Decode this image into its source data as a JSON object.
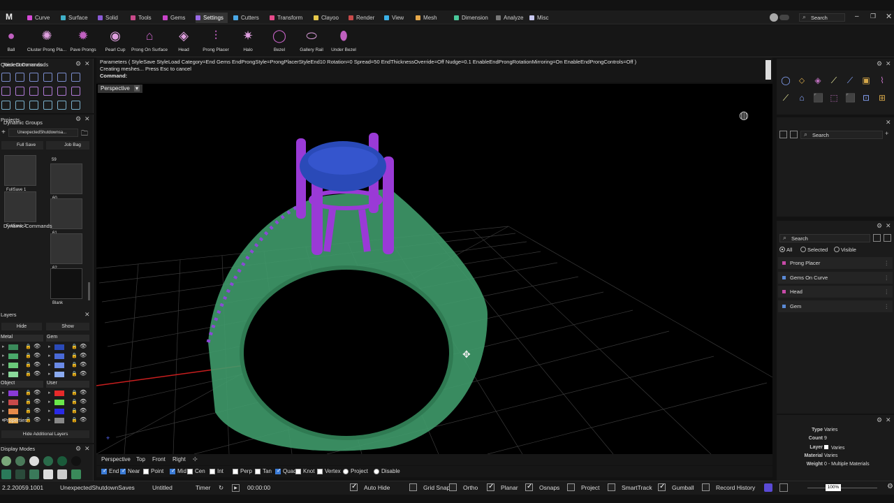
{
  "app": {
    "logo": "M"
  },
  "tabs": [
    {
      "label": "Curve",
      "color": "#d64ad6"
    },
    {
      "label": "Surface",
      "color": "#3fb0c8"
    },
    {
      "label": "Solid",
      "color": "#8a5ad6"
    },
    {
      "label": "Tools",
      "color": "#c84a8a"
    },
    {
      "label": "Gems",
      "color": "#c844c8"
    },
    {
      "label": "Settings",
      "color": "#9a6ae6"
    },
    {
      "label": "Cutters",
      "color": "#4aa8e6"
    },
    {
      "label": "Transform",
      "color": "#e64a8a"
    },
    {
      "label": "Clayoo",
      "color": "#e6c84a"
    },
    {
      "label": "Render",
      "color": "#c84a4a"
    },
    {
      "label": "View",
      "color": "#3ab0e6"
    },
    {
      "label": "Mesh",
      "color": "#e6a84a"
    },
    {
      "label": "Dimension",
      "color": "#4ac89a"
    },
    {
      "label": "Analyze",
      "color": "#777777"
    },
    {
      "label": "Misc",
      "color": "#c8c8f0"
    }
  ],
  "top_search": "Search",
  "tools": [
    "Ball",
    "Cluster Prong Pla...",
    "Pave Prongs",
    "Pearl Cup",
    "Prong On Surface",
    "Head",
    "Prong Placer",
    "Halo",
    "Bezel",
    "Gallery Rail",
    "Under Bezel"
  ],
  "command": {
    "line1": "Parameters ( StyleSave StyleLoad Category=End Gems EndProngStyle=ProngPlacerStyleEnd10 Rotation=0 Spread=50 EndThicknessOverride=Off Nudge=0.1 EnableEndProngRotationMirroring=On EnableEndProngControls=Off )",
    "line2": "Creating meshes... Press Esc to cancel",
    "line3": "Command:"
  },
  "viewport_label": "Perspective",
  "panels": {
    "quick_commands": "Quick Commands",
    "projects": "Projects",
    "project_name": "UnexpectedShutdownsa...",
    "full_save": "Full Save",
    "job_bag": "Job Bag",
    "thumbs": [
      {
        "num": "",
        "cap": "FullSave 1"
      },
      {
        "num": "59",
        "cap": "60"
      },
      {
        "num": "",
        "cap": "FullSave 2"
      },
      {
        "num": "",
        "cap": "61"
      },
      {
        "num": "",
        "cap": "62"
      },
      {
        "num": "",
        "cap": "Blank"
      }
    ],
    "layers": "Layers",
    "hide": "Hide",
    "show": "Show",
    "layer_groups": [
      "Metal",
      "Gem",
      "Object",
      "User"
    ],
    "hide_additional": "Hide Additional Layers",
    "display_modes": "Display Modes"
  },
  "right": {
    "recent": "Recent Commands",
    "dyn_groups": "Dynamic Groups",
    "dyn_groups_search": "Search",
    "dyn_cmds": "Dynamic Commands",
    "dyn_cmds_search": "Search",
    "filters": [
      "All",
      "Selected",
      "Visible"
    ],
    "dyn_items": [
      {
        "label": "Prong Placer",
        "color": "#c84aa8"
      },
      {
        "label": "Gems On Curve",
        "color": "#5a8ad6"
      },
      {
        "label": "Head",
        "color": "#c84aa8"
      },
      {
        "label": "Gem",
        "color": "#5a8ad6"
      }
    ],
    "properties": "Properties",
    "props": [
      {
        "k": "Type",
        "v": "Varies"
      },
      {
        "k": "Count",
        "v": "9"
      },
      {
        "k": "Layer",
        "v": "Varies"
      },
      {
        "k": "Material",
        "v": "Varies"
      },
      {
        "k": "Weight",
        "v": "0 - Multiple Materials"
      }
    ]
  },
  "view_tabs": [
    "Perspective",
    "Top",
    "Front",
    "Right"
  ],
  "snaps": [
    {
      "label": "End",
      "on": true
    },
    {
      "label": "Near",
      "on": true
    },
    {
      "label": "Point",
      "on": false
    },
    {
      "label": "Mid",
      "on": true
    },
    {
      "label": "Cen",
      "on": false
    },
    {
      "label": "Int",
      "on": false
    },
    {
      "label": "Perp",
      "on": false
    },
    {
      "label": "Tan",
      "on": false
    },
    {
      "label": "Quad",
      "on": true
    },
    {
      "label": "Knot",
      "on": false
    },
    {
      "label": "Vertex",
      "on": false
    },
    {
      "label": "Project",
      "on": false
    },
    {
      "label": "Disable",
      "on": false
    }
  ],
  "status": {
    "version": "2.2.20059.1001",
    "saves": "UnexpectedShutdownSaves",
    "file": "Untitled",
    "timer": "Timer",
    "time": "00:00:00",
    "toggles": [
      {
        "label": "Auto Hide",
        "on": true
      },
      {
        "label": "Grid Snaps",
        "on": false
      },
      {
        "label": "Ortho",
        "on": false
      },
      {
        "label": "Planar",
        "on": true
      },
      {
        "label": "Osnaps",
        "on": true
      },
      {
        "label": "Project",
        "on": false
      },
      {
        "label": "SmartTrack",
        "on": false
      },
      {
        "label": "Gumball",
        "on": true
      },
      {
        "label": "Record History",
        "on": false
      }
    ],
    "zoom": "100%"
  }
}
